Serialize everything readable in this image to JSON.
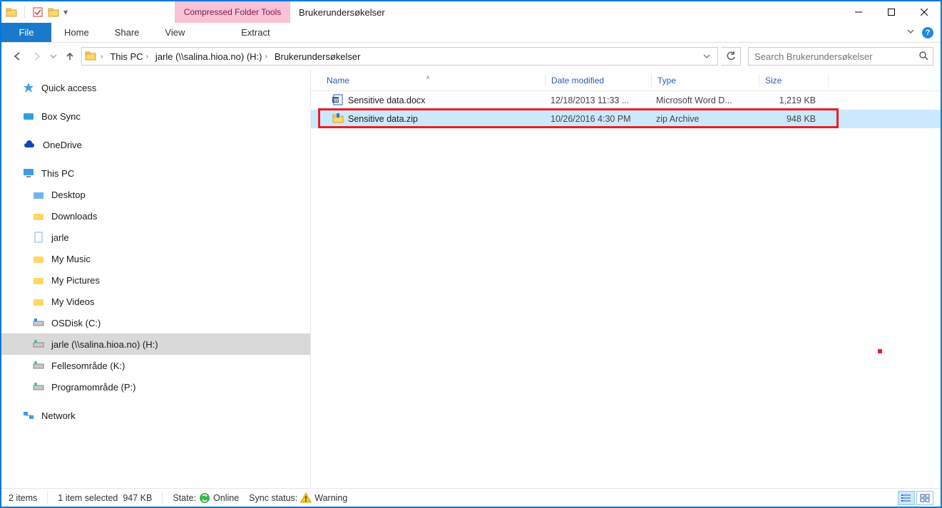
{
  "title": "Brukerundersøkelser",
  "context_tab": "Compressed Folder Tools",
  "ribbon": {
    "file": "File",
    "home": "Home",
    "share": "Share",
    "view": "View",
    "extract": "Extract"
  },
  "breadcrumbs": [
    "This PC",
    "jarle (\\\\salina.hioa.no) (H:)",
    "Brukerundersøkelser"
  ],
  "search_placeholder": "Search Brukerundersøkelser",
  "nav": {
    "quick_access": "Quick access",
    "box_sync": "Box Sync",
    "onedrive": "OneDrive",
    "this_pc": "This PC",
    "children": [
      "Desktop",
      "Downloads",
      "jarle",
      "My Music",
      "My Pictures",
      "My Videos",
      "OSDisk (C:)",
      "jarle (\\\\salina.hioa.no) (H:)",
      "Fellesområde (K:)",
      "Programområde (P:)"
    ],
    "network": "Network"
  },
  "columns": {
    "name": "Name",
    "date": "Date modified",
    "type": "Type",
    "size": "Size"
  },
  "files": [
    {
      "name": "Sensitive data.docx",
      "date": "12/18/2013 11:33 ...",
      "type": "Microsoft Word D...",
      "size": "1,219 KB",
      "icon": "word",
      "selected": false
    },
    {
      "name": "Sensitive data.zip",
      "date": "10/26/2016 4:30 PM",
      "type": "zip Archive",
      "size": "948 KB",
      "icon": "zip",
      "selected": true
    }
  ],
  "status": {
    "items": "2 items",
    "selected": "1 item selected",
    "sel_size": "947 KB",
    "state_label": "State:",
    "state_value": "Online",
    "sync_label": "Sync status:",
    "sync_value": "Warning"
  }
}
